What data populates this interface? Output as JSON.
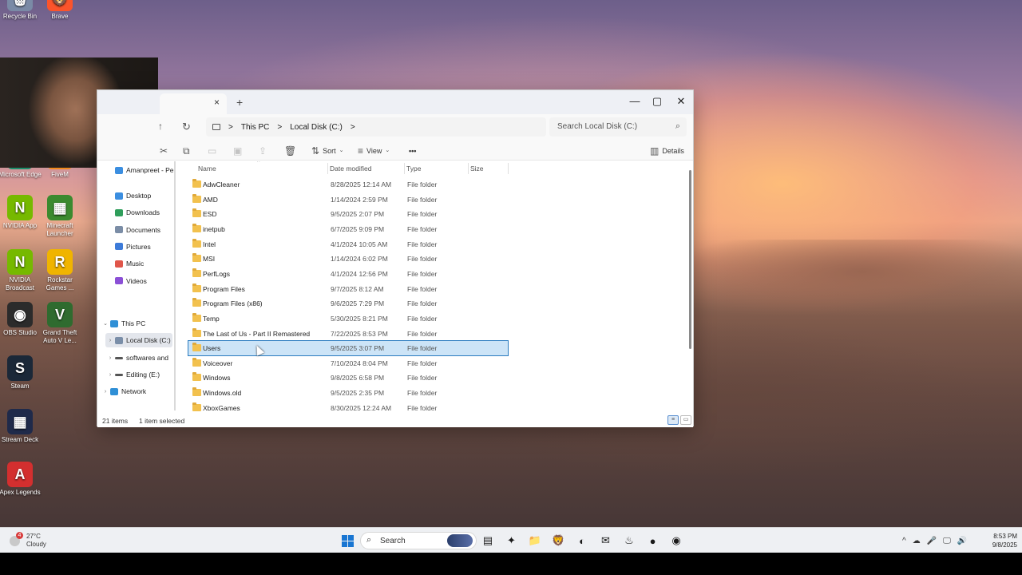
{
  "desktop": {
    "icons": [
      {
        "label": "Recycle Bin",
        "glyph": "🗑",
        "color": "#7a8aa6"
      },
      {
        "label": "Brave",
        "glyph": "🦁",
        "color": "#fb542b"
      },
      {
        "label": "Microsoft Edge",
        "glyph": "e",
        "color": "#1b8f6b"
      },
      {
        "label": "FiveM",
        "glyph": "F",
        "color": "#f18a1c"
      },
      {
        "label": "NVIDIA App",
        "glyph": "N",
        "color": "#76b900"
      },
      {
        "label": "Minecraft Launcher",
        "glyph": "▦",
        "color": "#3b8a2f"
      },
      {
        "label": "NVIDIA Broadcast",
        "glyph": "N",
        "color": "#76b900"
      },
      {
        "label": "Rockstar Games ...",
        "glyph": "R",
        "color": "#f0b400"
      },
      {
        "label": "OBS Studio",
        "glyph": "◉",
        "color": "#2b2b2b"
      },
      {
        "label": "Grand Theft Auto V Le...",
        "glyph": "V",
        "color": "#2f6b2f"
      },
      {
        "label": "Steam",
        "glyph": "S",
        "color": "#1b2838"
      },
      {
        "label": "Stream Deck",
        "glyph": "▦",
        "color": "#1f2a4a"
      },
      {
        "label": "Apex Legends",
        "glyph": "A",
        "color": "#d32f2f"
      }
    ]
  },
  "explorer": {
    "tab_close": "×",
    "tab_new": "+",
    "window_controls": {
      "minimize": "—",
      "maximize": "▢",
      "close": "✕"
    },
    "nav": {
      "up": "↑",
      "refresh": "↻"
    },
    "breadcrumb": [
      "This PC",
      "Local Disk (C:)"
    ],
    "breadcrumb_sep": ">",
    "search_placeholder": "Search Local Disk (C:)",
    "toolbar": {
      "sort": "Sort",
      "view": "View",
      "more": "•••",
      "details": "Details"
    },
    "sidebar": {
      "top_partial": "Amanpreet - Pe",
      "quick_access": [
        {
          "label": "Desktop",
          "color": "#3b8ee0"
        },
        {
          "label": "Downloads",
          "color": "#2f9e5b"
        },
        {
          "label": "Documents",
          "color": "#7b8da6"
        },
        {
          "label": "Pictures",
          "color": "#3d7bd9"
        },
        {
          "label": "Music",
          "color": "#e0564a"
        },
        {
          "label": "Videos",
          "color": "#8b4fd6"
        }
      ],
      "pin_glyph": "📌",
      "this_pc": "This PC",
      "drives": [
        "Local Disk (C:)",
        "softwares and",
        "Editing  (E:)"
      ],
      "network": "Network"
    },
    "columns": {
      "name": "Name",
      "date": "Date modified",
      "type": "Type",
      "size": "Size"
    },
    "files": [
      {
        "name": "AdwCleaner",
        "date": "8/28/2025 12:14 AM",
        "type": "File folder"
      },
      {
        "name": "AMD",
        "date": "1/14/2024 2:59 PM",
        "type": "File folder"
      },
      {
        "name": "ESD",
        "date": "9/5/2025 2:07 PM",
        "type": "File folder"
      },
      {
        "name": "inetpub",
        "date": "6/7/2025 9:09 PM",
        "type": "File folder"
      },
      {
        "name": "Intel",
        "date": "4/1/2024 10:05 AM",
        "type": "File folder"
      },
      {
        "name": "MSI",
        "date": "1/14/2024 6:02 PM",
        "type": "File folder"
      },
      {
        "name": "PerfLogs",
        "date": "4/1/2024 12:56 PM",
        "type": "File folder"
      },
      {
        "name": "Program Files",
        "date": "9/7/2025 8:12 AM",
        "type": "File folder"
      },
      {
        "name": "Program Files (x86)",
        "date": "9/6/2025 7:29 PM",
        "type": "File folder"
      },
      {
        "name": "Temp",
        "date": "5/30/2025 8:21 PM",
        "type": "File folder"
      },
      {
        "name": "The Last of Us - Part II Remastered",
        "date": "7/22/2025 8:53 PM",
        "type": "File folder"
      },
      {
        "name": "Users",
        "date": "9/5/2025 3:07 PM",
        "type": "File folder",
        "selected": true
      },
      {
        "name": "Voiceover",
        "date": "7/10/2024 8:04 PM",
        "type": "File folder"
      },
      {
        "name": "Windows",
        "date": "9/8/2025 6:58 PM",
        "type": "File folder"
      },
      {
        "name": "Windows.old",
        "date": "9/5/2025 2:35 PM",
        "type": "File folder"
      },
      {
        "name": "XboxGames",
        "date": "8/30/2025 12:24 AM",
        "type": "File folder"
      }
    ],
    "status": {
      "count": "21 items",
      "selected": "1 item selected"
    }
  },
  "taskbar": {
    "weather": {
      "temp": "27°C",
      "condition": "Cloudy",
      "alert": "4"
    },
    "search_label": "Search",
    "apps": [
      "▤",
      "✦",
      "📁",
      "🦁",
      "◐",
      "✉",
      "♨",
      "●",
      "◉"
    ],
    "tray": [
      "^",
      "☁",
      "🎤",
      "🖵",
      "🔊"
    ],
    "clock_time": "8:53 PM",
    "clock_date": "9/8/2025"
  }
}
